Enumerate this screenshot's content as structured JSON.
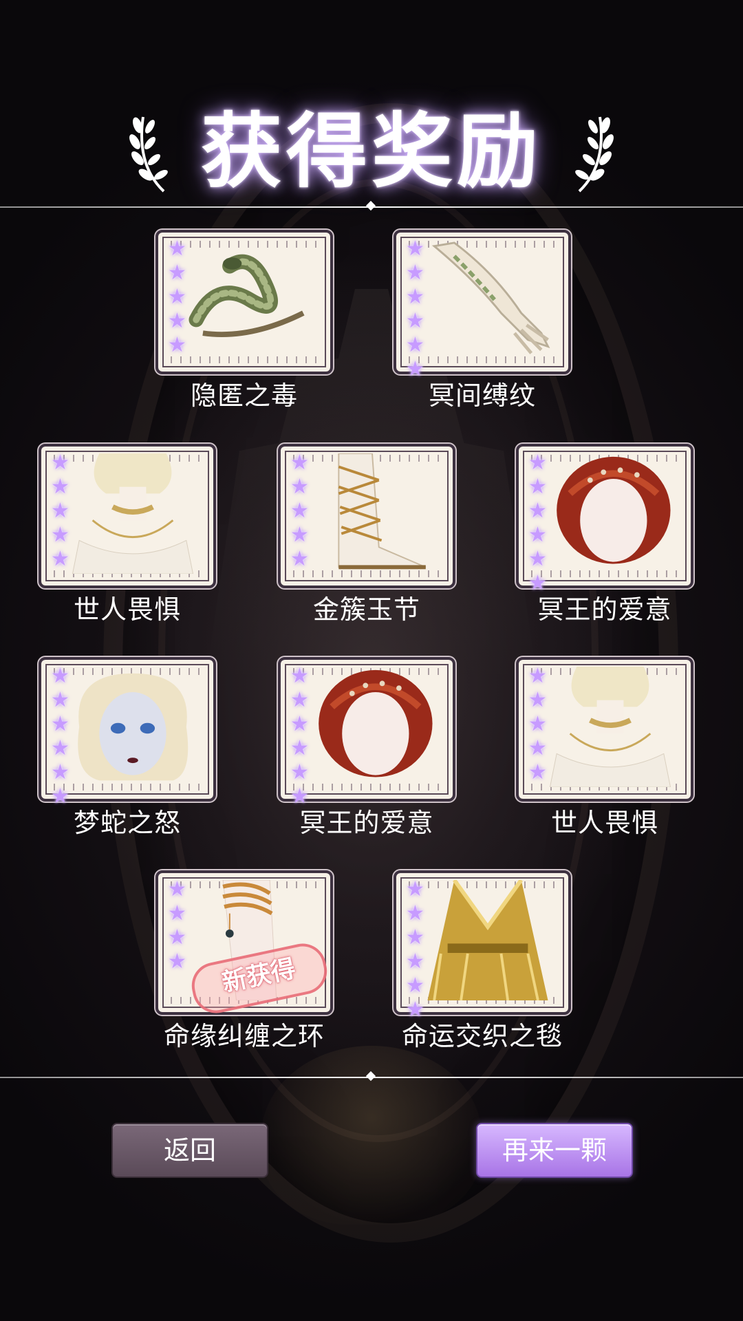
{
  "header": {
    "title": "获得奖励"
  },
  "rewards": [
    {
      "name": "隐匿之毒",
      "stars": "★★★★★",
      "icon": "snake-bracelet-icon"
    },
    {
      "name": "冥间缚纹",
      "stars": "★★★★★★",
      "icon": "arm-tattoo-icon"
    },
    {
      "name": "世人畏惧",
      "stars": "★★★★★",
      "icon": "necklace-icon"
    },
    {
      "name": "金簇玉节",
      "stars": "★★★★★",
      "icon": "sandals-icon"
    },
    {
      "name": "冥王的爱意",
      "stars": "★★★★★★",
      "icon": "red-hair-icon"
    },
    {
      "name": "梦蛇之怒",
      "stars": "★★★★★★",
      "icon": "face-makeup-icon"
    },
    {
      "name": "冥王的爱意",
      "stars": "★★★★★★",
      "icon": "red-hair-icon"
    },
    {
      "name": "世人畏惧",
      "stars": "★★★★★",
      "icon": "necklace-icon"
    },
    {
      "name": "命缘纠缠之环",
      "stars": "★★★★",
      "icon": "leg-ring-icon",
      "badge": "新获得"
    },
    {
      "name": "命运交织之毯",
      "stars": "★★★★★★",
      "icon": "gold-dress-icon"
    }
  ],
  "buttons": {
    "back": "返回",
    "again": "再来一颗"
  },
  "colors": {
    "star": "#c79bff",
    "primary_button": "#b98af0",
    "secondary_button": "#6a5868",
    "new_badge": "#e86e78"
  }
}
